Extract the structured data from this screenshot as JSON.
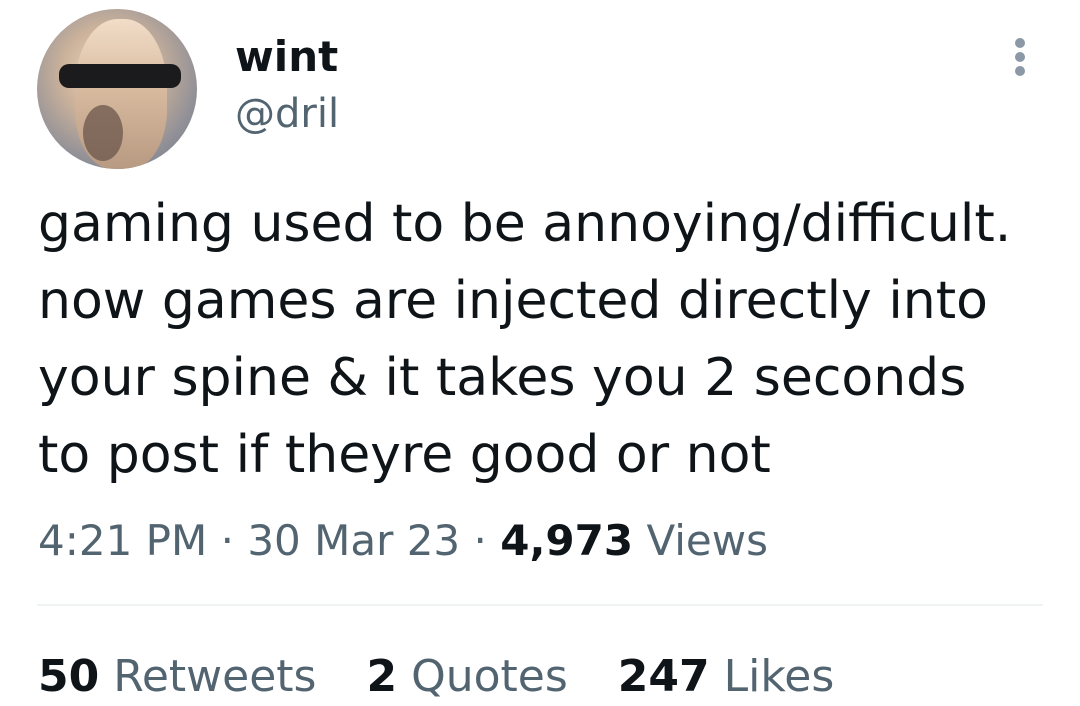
{
  "author": {
    "display_name": "wint",
    "handle": "@dril"
  },
  "tweet": {
    "lines": [
      "gaming used to be annoying/difficult.",
      "now games are injected directly into",
      "your spine & it takes you 2 seconds",
      "to post if theyre good or not"
    ],
    "time": "4:21 PM",
    "date": "30 Mar 23",
    "separator": "·",
    "views_count": "4,973",
    "views_label": "Views"
  },
  "stats": {
    "retweets_count": "50",
    "retweets_label": "Retweets",
    "quotes_count": "2",
    "quotes_label": "Quotes",
    "likes_count": "247",
    "likes_label": "Likes"
  },
  "icons": {
    "more": "more-vertical-icon"
  },
  "colors": {
    "text": "#0f1419",
    "secondary": "#536471",
    "divider": "#eff3f4"
  }
}
